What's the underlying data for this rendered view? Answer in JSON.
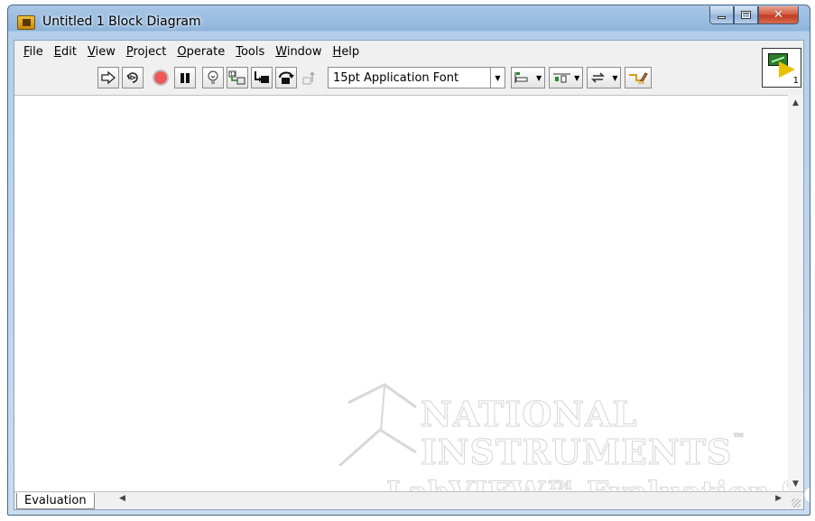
{
  "window": {
    "title": "Untitled 1 Block Diagram",
    "close_glyph": "✕"
  },
  "menu": {
    "items": [
      {
        "name": "file",
        "accel": "F",
        "rest": "ile"
      },
      {
        "name": "edit",
        "accel": "E",
        "rest": "dit"
      },
      {
        "name": "view",
        "accel": "V",
        "rest": "iew"
      },
      {
        "name": "project",
        "accel": "P",
        "rest": "roject"
      },
      {
        "name": "operate",
        "accel": "O",
        "rest": "perate"
      },
      {
        "name": "tools",
        "accel": "T",
        "rest": "ools"
      },
      {
        "name": "window",
        "accel": "W",
        "rest": "indow"
      },
      {
        "name": "help",
        "accel": "H",
        "rest": "elp"
      }
    ]
  },
  "toolbar": {
    "font": "15pt Application Font",
    "icons": [
      "run-icon",
      "run-continuously-icon",
      "abort-icon",
      "pause-icon",
      "highlight-execution-icon",
      "retain-wire-values-icon",
      "step-into-icon",
      "step-over-icon",
      "step-out-icon",
      "align-objects-icon",
      "distribute-objects-icon",
      "reorder-icon",
      "cleanup-diagram-icon"
    ]
  },
  "vi_icon": {
    "number": "1"
  },
  "status": {
    "tab_label": "Evaluation"
  },
  "watermark": {
    "line1": "NATIONAL",
    "line2": "INSTRUMENTS",
    "trademark": "™",
    "line3": "LabVIEW™ Evaluation Software"
  },
  "colors": {
    "titlebar": "#8fb4dc",
    "abort_red": "#e03030",
    "watermark_stroke": "#d6d6d6"
  }
}
